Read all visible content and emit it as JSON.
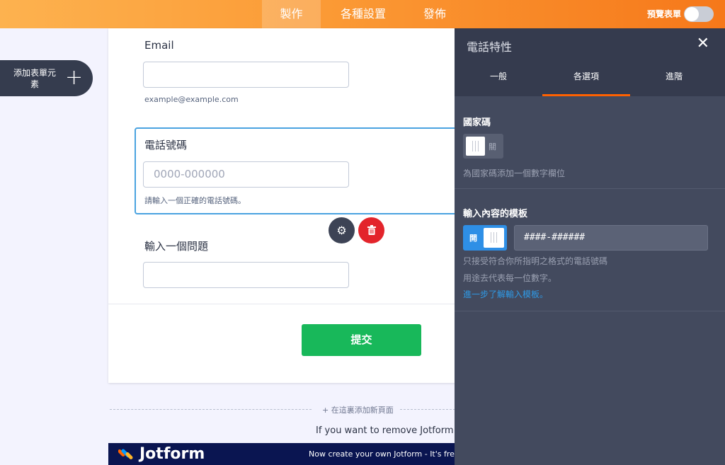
{
  "topbar": {
    "tabs": [
      "製作",
      "各種設置",
      "發佈"
    ],
    "active_tab": 0,
    "preview_label": "預覽表單"
  },
  "add_element": {
    "label": "添加表單元素"
  },
  "form": {
    "email_label": "Email",
    "email_sublabel": "example@example.com",
    "phone_label": "電話號碼",
    "phone_placeholder": "0000-000000",
    "phone_sublabel": "請輸入一個正確的電話號碼。",
    "question_label": "輸入一個問題",
    "submit_label": "提交",
    "add_page": "+ 在這裏添加新頁面",
    "branding_text": "If you want to remove Jotform Bra",
    "jotform_name": "Jotform",
    "jotform_cta": "Now create your own Jotform - It's free"
  },
  "panel": {
    "title": "電話特性",
    "tabs": [
      "一般",
      "各選項",
      "進階"
    ],
    "active_tab": 1,
    "country_code": {
      "title": "國家碼",
      "toggle_text": "關",
      "toggle_on": false,
      "description": "為國家碼添加一個數字欄位"
    },
    "input_mask": {
      "title": "輸入內容的模板",
      "toggle_text": "開",
      "toggle_on": true,
      "value": "####-######",
      "desc_line1": "只接受符合你所指明之格式的電話號碼",
      "desc_line2": "用途去代表每一位數字。",
      "link": "進一步了解輸入模板。"
    }
  },
  "colors": {
    "accent": "#ff6100",
    "topbar_gradient": [
      "#fdb24f",
      "#f6781a"
    ],
    "submit": "#18b85a",
    "toggle_on": "#2e8fe6",
    "delete": "#e3242b",
    "panel_bg": "#434a5e"
  }
}
